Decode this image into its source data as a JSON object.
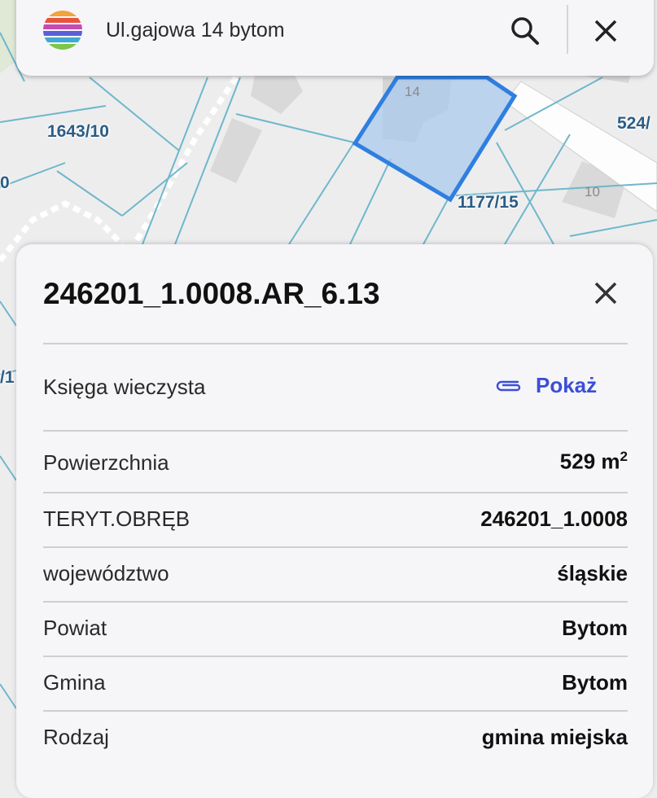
{
  "map": {
    "labels": {
      "parcel_1643_10": "1643/10",
      "parcel_1177_15": "1177/15",
      "parcel_524": "524/",
      "edge_left_0": "0",
      "edge_left_1": "/1"
    },
    "house_numbers": {
      "h14": "14",
      "h10": "10"
    },
    "selected_parcel_color": "#2f7fe0"
  },
  "search": {
    "query": "Ul.gajowa 14 bytom",
    "icons": {
      "search": "search-icon",
      "close": "close-icon",
      "logo": "rainbow-logo-icon"
    }
  },
  "panel": {
    "title": "246201_1.0008.AR_6.13",
    "land_registry": {
      "label": "Księga wieczysta",
      "link_label": "Pokaż",
      "link_icon": "paperclip-icon",
      "link_color": "#3b4fd6"
    },
    "rows": [
      {
        "label": "Powierzchnia",
        "value": "529 m",
        "sup": "2"
      },
      {
        "label": "TERYT.OBRĘB",
        "value": "246201_1.0008"
      },
      {
        "label": "województwo",
        "value": "śląskie"
      },
      {
        "label": "Powiat",
        "value": "Bytom"
      },
      {
        "label": "Gmina",
        "value": "Bytom"
      },
      {
        "label": "Rodzaj",
        "value": "gmina miejska"
      }
    ]
  }
}
